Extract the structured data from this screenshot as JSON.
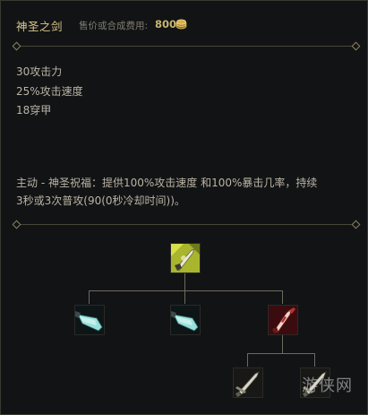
{
  "item": {
    "name": "神圣之剑",
    "cost_label": "售价或合成费用:",
    "cost_value": "800"
  },
  "stats": [
    "30攻击力",
    "25%攻击速度",
    "18穿甲"
  ],
  "active": {
    "line1": "主动 - 神圣祝福：提供100%攻击速度 和100%暴击几率，持续",
    "line2": "3秒或3次普攻(90(0秒冷却时间))。"
  },
  "recipe_tree": {
    "root": "divine-sword-icon",
    "children": [
      "cyan-blade-icon",
      "cyan-blade-icon",
      "crimson-dagger-icon"
    ],
    "grandchildren": [
      "steel-sword-icon",
      "steel-sword-icon"
    ]
  },
  "watermark": "游侠网",
  "colors": {
    "title_gold": "#d9c98e",
    "cost_gold": "#c8b670",
    "text": "#b9b4a4",
    "line": "#4a4738",
    "background": "#121315"
  }
}
